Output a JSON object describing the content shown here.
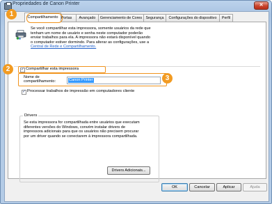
{
  "window": {
    "title": "Propriedades de Canon Printer",
    "close_label": "✕"
  },
  "tabs": [
    {
      "label": "Compartilhamento",
      "active": true
    },
    {
      "label": "Portas",
      "active": false
    },
    {
      "label": "Avançado",
      "active": false
    },
    {
      "label": "Gerenciamento de Cores",
      "active": false
    },
    {
      "label": "Segurança",
      "active": false
    },
    {
      "label": "Configurações do dispositivo",
      "active": false
    },
    {
      "label": "Perfil",
      "active": false
    }
  ],
  "sharing": {
    "intro_lines": [
      "Se você compartilhar esta impressora, somente usuários da rede que",
      "tenham um nome de usuário e senha neste computador poderão",
      "enviar trabalhos para ela. A impressora não estará disponível quando",
      "o computador estiver dormindo. Para alterar as configurações, use a"
    ],
    "intro_link": "Central de Rede e Compartilhamento.",
    "share_checkbox_label": "Compartilhar esta impressora",
    "share_checked": true,
    "share_name_label_1": "Nome de",
    "share_name_label_2": "compartilhamento:",
    "share_name_value": "Canon Printer",
    "render_checkbox_label": "Processar trabalhos de impressão em computadores cliente",
    "render_checked": true
  },
  "drivers": {
    "title": "Drivers",
    "text_lines": [
      "Se esta impressora for compartilhada entre usuários que executam",
      "diferentes versões do Windows, convém instalar drivers de",
      "impressora adicionais para que os usuários não precisem procurar",
      "por um driver quando se conectarem à impressora compartilhada."
    ],
    "additional_drivers_button": "Drivers Adicionais..."
  },
  "footer": {
    "ok": "OK",
    "cancel": "Cancelar",
    "apply": "Aplicar",
    "help": "Ajuda"
  },
  "callouts": {
    "one": "1",
    "two": "2",
    "three": "3"
  },
  "colors": {
    "callout": "#f29b22",
    "highlight": "#f0931c",
    "link": "#1f5fc9",
    "selection": "#3399ff"
  }
}
